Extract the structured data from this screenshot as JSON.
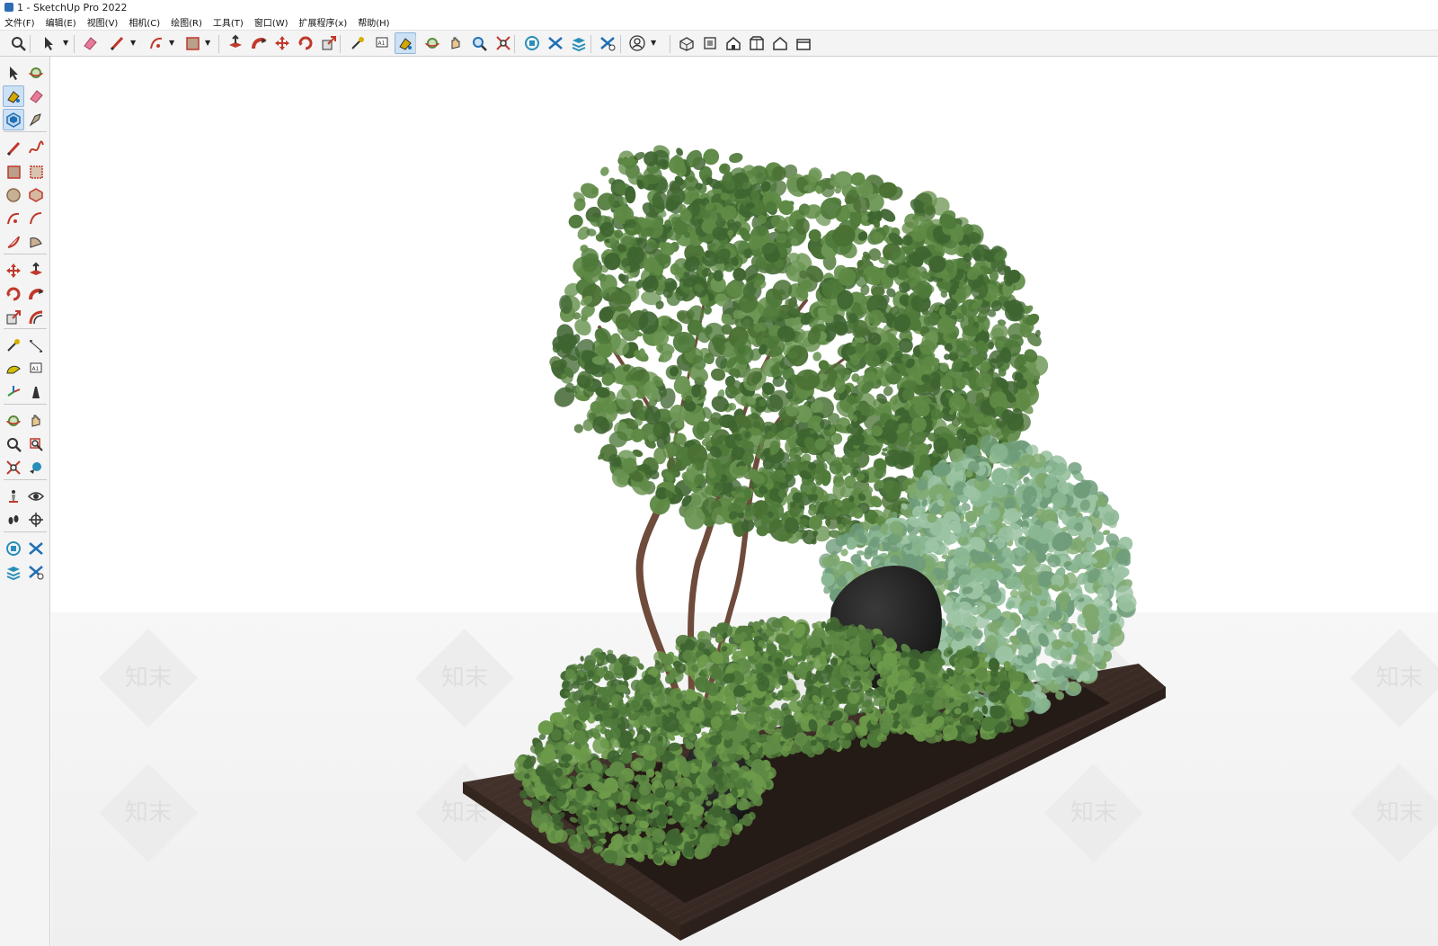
{
  "window": {
    "title": "1 - SketchUp Pro 2022",
    "app_icon": "sketchup-logo-icon"
  },
  "menu": {
    "items": [
      "文件(F)",
      "编辑(E)",
      "视图(V)",
      "相机(C)",
      "绘图(R)",
      "工具(T)",
      "窗口(W)",
      "扩展程序(x)",
      "帮助(H)"
    ]
  },
  "toolbar": {
    "icons": [
      "zoom-icon",
      "select-icon",
      "eraser-icon",
      "pencil-icon",
      "arc-icon",
      "rectangle-icon",
      "push-pull-icon",
      "follow-me-icon",
      "move-icon",
      "rotate-icon",
      "scale-icon",
      "tape-measure-icon",
      "text-icon",
      "paint-bucket-icon",
      "orbit-icon",
      "pan-icon",
      "zoom-tool-icon",
      "zoom-extents-icon",
      "warehouse-icon",
      "extension-warehouse-icon",
      "layout-icon",
      "extension-manager-icon",
      "account-icon",
      "iso-view-icon",
      "top-view-icon",
      "front-view-icon",
      "right-view-icon",
      "back-view-icon",
      "left-view-icon"
    ],
    "active": "paint-bucket-icon"
  },
  "left_toolbar": {
    "icons": [
      "select-icon",
      "orbit-icon",
      "paint-bucket-icon",
      "eraser-icon",
      "make-component-icon",
      "tag-icon",
      "line-icon",
      "freehand-icon",
      "rectangle-icon",
      "rotated-rectangle-icon",
      "circle-icon",
      "polygon-icon",
      "arc-icon",
      "two-point-arc-icon",
      "three-point-arc-icon",
      "pie-icon",
      "move-icon",
      "push-pull-icon",
      "rotate-icon",
      "follow-me-icon",
      "scale-icon",
      "offset-icon",
      "tape-measure-icon",
      "dimension-icon",
      "protractor-icon",
      "text-icon",
      "axes-icon",
      "3d-text-icon",
      "orbit-tool-icon",
      "pan-icon",
      "zoom-icon",
      "zoom-window-icon",
      "zoom-extents-icon",
      "previous-view-icon",
      "position-camera-icon",
      "look-around-icon",
      "walk-icon",
      "section-plane-icon",
      "warehouse-icon",
      "extension-warehouse-icon",
      "layout-icon",
      "extension-manager-icon"
    ],
    "active": [
      "paint-bucket-icon",
      "make-component-icon"
    ]
  },
  "scene": {
    "watermark": "知末",
    "ground_color": "#f2f2f2",
    "planter_color": "#3b2c26",
    "foliage_colors": [
      "#4f7a3a",
      "#5f8a45",
      "#3e6430",
      "#7ea86e",
      "#8ab793"
    ],
    "rock_color": "#232323",
    "trunk_color": "#6e4b3a"
  }
}
